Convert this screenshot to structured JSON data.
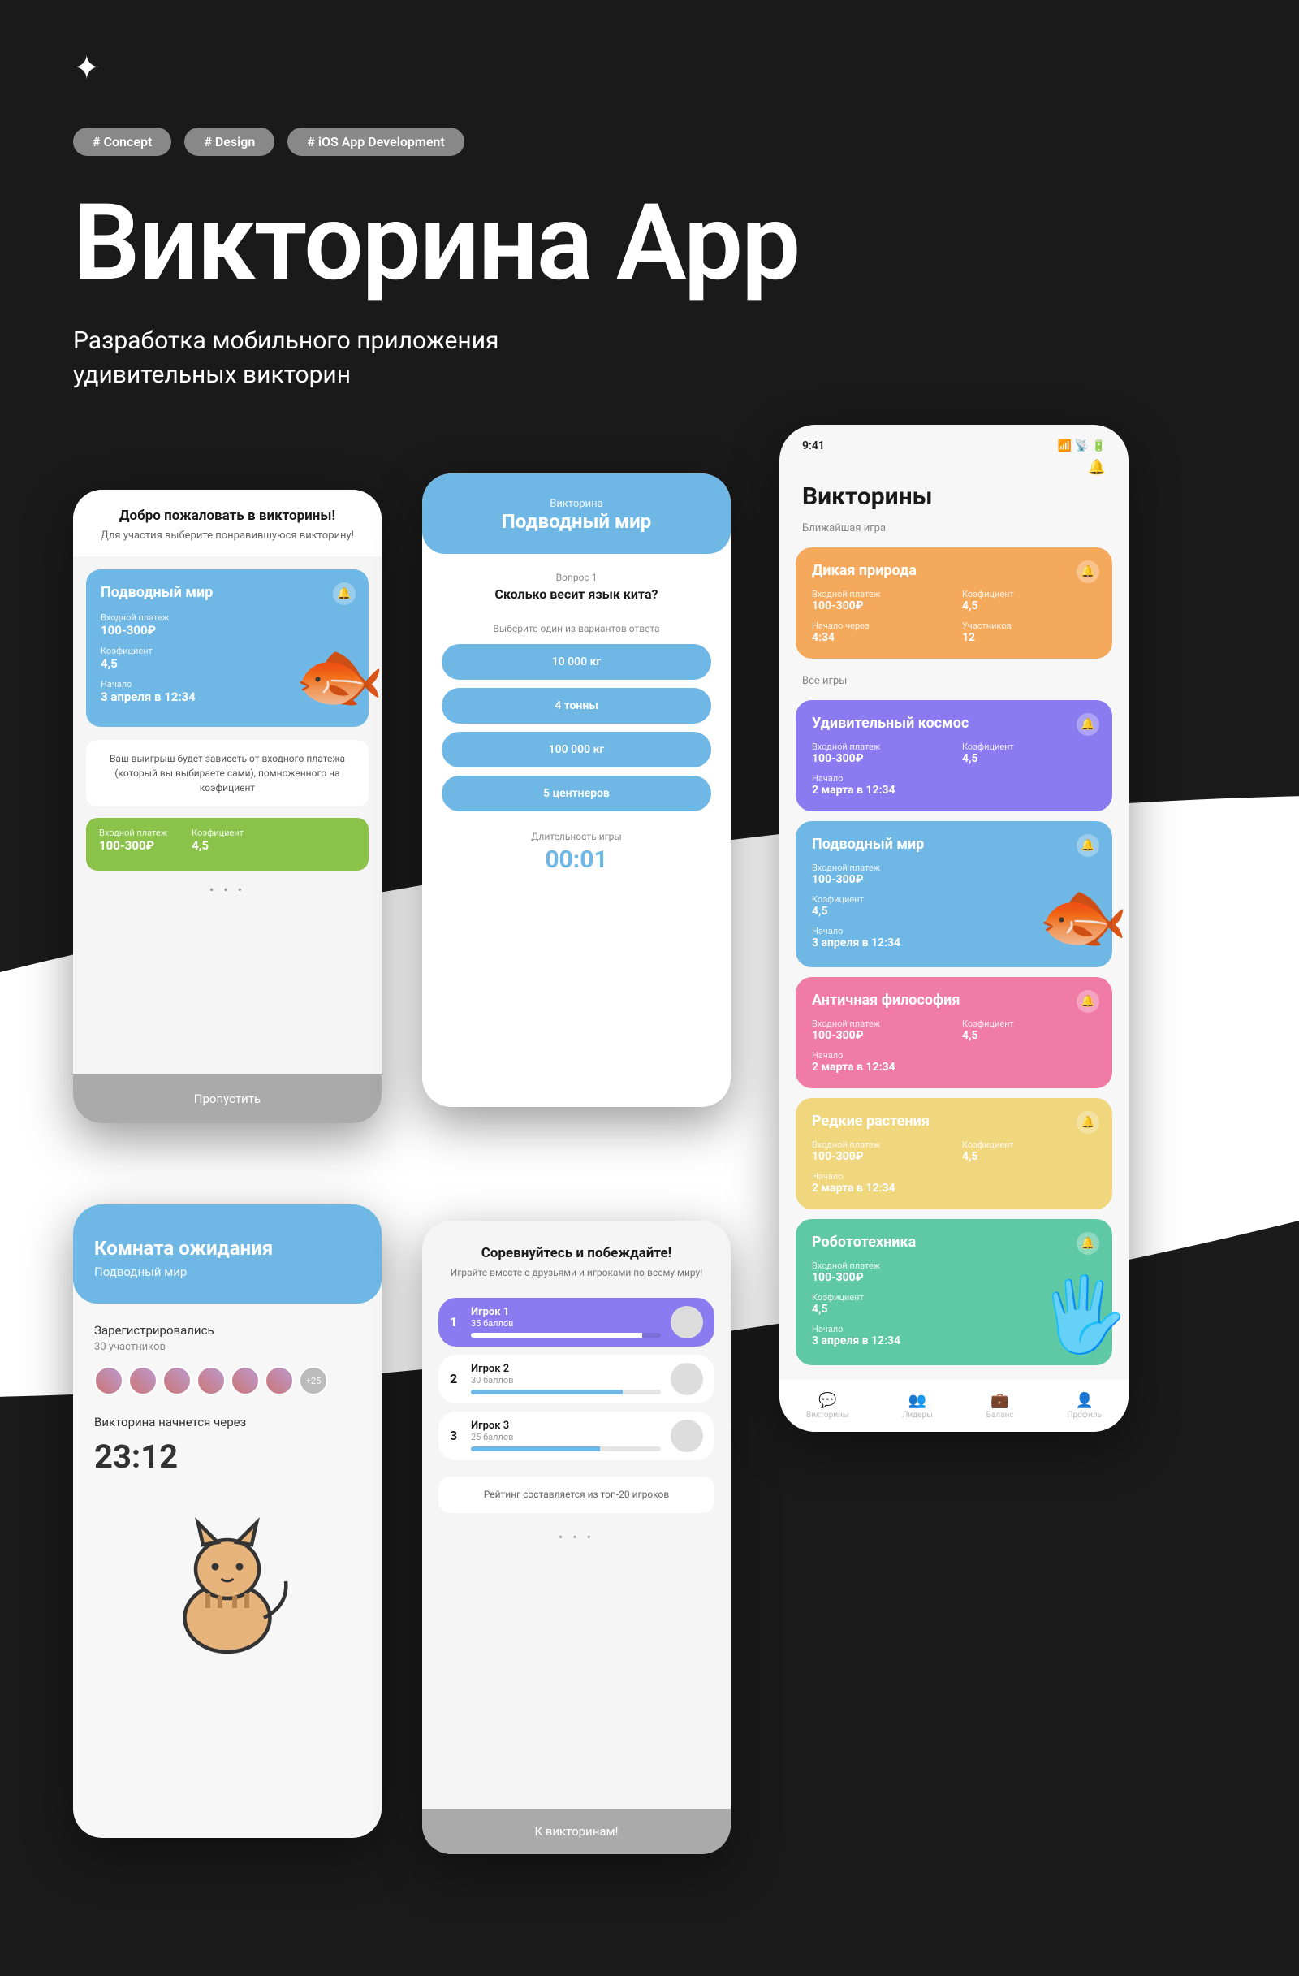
{
  "header": {
    "tags": [
      "# Concept",
      "# Design",
      "# iOS App Development"
    ],
    "title": "Викторина App",
    "subtitle": "Разработка мобильного приложения удивительных викторин"
  },
  "phone1": {
    "welcome_title": "Добро пожаловать в викторины!",
    "welcome_sub": "Для участия выберите понравившуюся викторину!",
    "card": {
      "title": "Подводный мир",
      "fee_label": "Входной платеж",
      "fee_value": "100-300₽",
      "coef_label": "Коэфициент",
      "coef_value": "4,5",
      "start_label": "Начало",
      "start_value": "3 апреля в 12:34"
    },
    "hint": "Ваш выигрыш будет зависеть от входного платежа (который вы выбираете сами), помноженного на коэфициент",
    "green_row": {
      "fee_label": "Входной платеж",
      "fee_value": "100-300₽",
      "coef_label": "Коэфициент",
      "coef_value": "4,5"
    },
    "skip": "Пропустить"
  },
  "phone2": {
    "pretitle": "Викторина",
    "title": "Подводный мир",
    "qnum": "Вопрос 1",
    "question": "Сколько весит язык кита?",
    "hint": "Выберите один из вариантов ответа",
    "answers": [
      "10 000 кг",
      "4 тонны",
      "100 000 кг",
      "5 центнеров"
    ],
    "dur_label": "Длительность игры",
    "timer": "00:01"
  },
  "phone3": {
    "title": "Комната ожидания",
    "sub": "Подводный мир",
    "reg_label": "Зарегистрировались",
    "reg_count": "30 участников",
    "more_badge": "+25",
    "start_label": "Викторина начнется через",
    "countdown": "23:12"
  },
  "phone4": {
    "title": "Соревнуйтесь и побеждайте!",
    "sub": "Играйте вместе с друзьями и игроками по всему миру!",
    "rows": [
      {
        "rank": "1",
        "name": "Игрок 1",
        "score": "35 баллов",
        "pct": 90
      },
      {
        "rank": "2",
        "name": "Игрок 2",
        "score": "30 баллов",
        "pct": 80
      },
      {
        "rank": "3",
        "name": "Игрок 3",
        "score": "25 баллов",
        "pct": 68
      }
    ],
    "note": "Рейтинг составляется из топ-20 игроков",
    "btn": "К викторинам!"
  },
  "phone5": {
    "time": "9:41",
    "page_title": "Викторины",
    "section_next": "Ближайшая игра",
    "section_all": "Все игры",
    "next": {
      "title": "Дикая природа",
      "fee_label": "Входной платеж",
      "fee": "100-300₽",
      "coef_label": "Коэфициент",
      "coef": "4,5",
      "start_in_label": "Начало через",
      "start_in": "4:34",
      "players_label": "Участников",
      "players": "12"
    },
    "games": [
      {
        "color": "purple",
        "title": "Удивительный космос",
        "fee_label": "Входной платеж",
        "fee": "100-300₽",
        "coef_label": "Коэфициент",
        "coef": "4,5",
        "start_label": "Начало",
        "start": "2 марта в 12:34"
      },
      {
        "color": "blue",
        "tall": true,
        "title": "Подводный мир",
        "fee_label": "Входной платеж",
        "fee": "100-300₽",
        "coef_label": "Коэфициент",
        "coef": "4,5",
        "start_label": "Начало",
        "start": "3 апреля в 12:34"
      },
      {
        "color": "pink",
        "title": "Античная философия",
        "fee_label": "Входной платеж",
        "fee": "100-300₽",
        "coef_label": "Коэфициент",
        "coef": "4,5",
        "start_label": "Начало",
        "start": "2 марта в 12:34"
      },
      {
        "color": "yellow",
        "title": "Редкие растения",
        "fee_label": "Входной платеж",
        "fee": "100-300₽",
        "coef_label": "Коэфициент",
        "coef": "4,5",
        "start_label": "Начало",
        "start": "2 марта в 12:34"
      },
      {
        "color": "green",
        "tall": true,
        "title": "Робототехника",
        "fee_label": "Входной платеж",
        "fee": "100-300₽",
        "coef_label": "Коэфициент",
        "coef": "4,5",
        "start_label": "Начало",
        "start": "3 апреля в 12:34"
      }
    ],
    "tabs": [
      "Викторины",
      "Лидеры",
      "Баланс",
      "Профиль"
    ]
  }
}
